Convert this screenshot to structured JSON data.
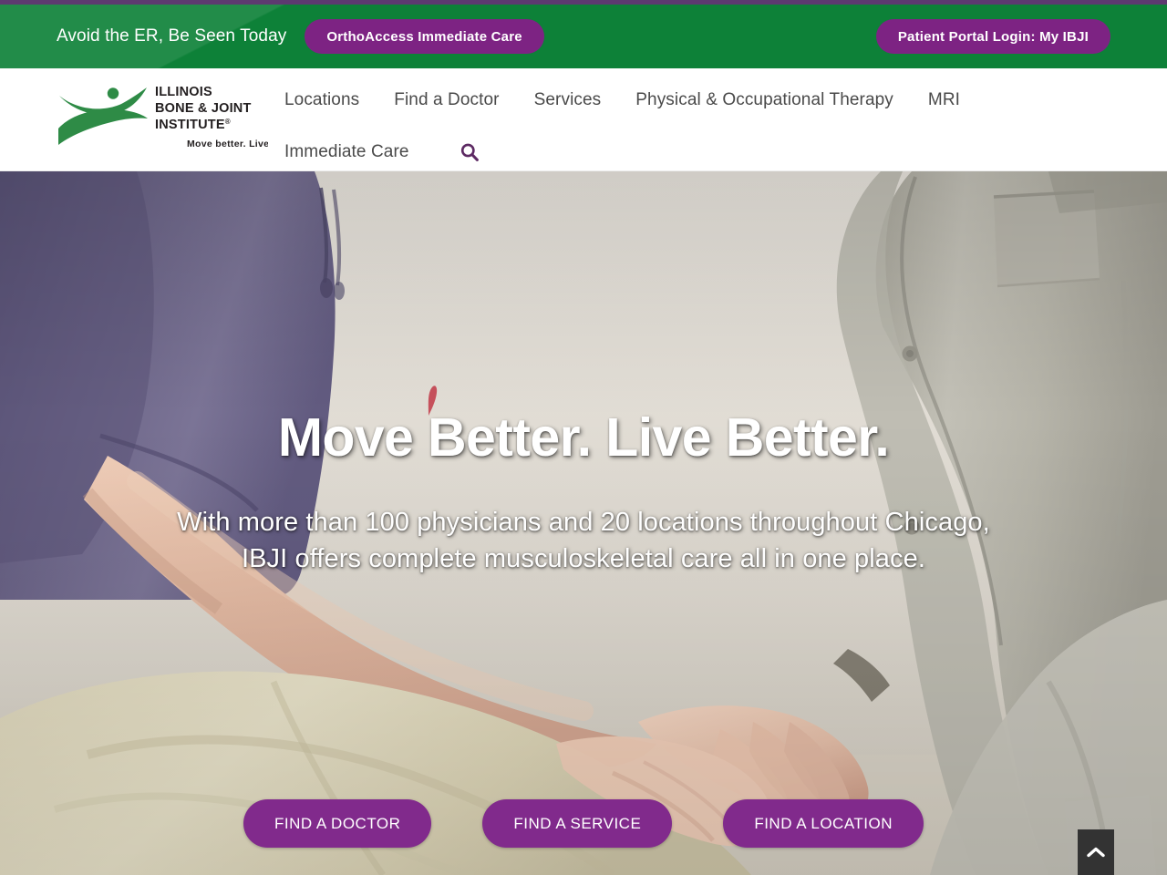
{
  "utility_bar": {
    "tagline": "Avoid the ER, Be Seen Today",
    "ortho_button": "OrthoAccess Immediate Care",
    "portal_button": "Patient Portal Login: My IBJI",
    "background_color": "#0d8138",
    "accent_color": "#7d2383",
    "strip_color": "#5d3a70"
  },
  "logo": {
    "line1": "ILLINOIS",
    "line2": "BONE & JOINT",
    "line3": "INSTITUTE",
    "registered_mark": "®",
    "tagline": "Move better. Live better.",
    "mark_color": "#2e8b46",
    "text_color": "#231f20"
  },
  "nav": {
    "row1": [
      {
        "label": "Locations",
        "name": "nav-item-locations"
      },
      {
        "label": "Find a Doctor",
        "name": "nav-item-find-a-doctor"
      },
      {
        "label": "Services",
        "name": "nav-item-services"
      },
      {
        "label": "Physical & Occupational Therapy",
        "name": "nav-item-physical-occupational-therapy"
      },
      {
        "label": "MRI",
        "name": "nav-item-mri"
      }
    ],
    "row2": [
      {
        "label": "Immediate Care",
        "name": "nav-item-immediate-care"
      }
    ],
    "search_icon": "search-icon",
    "search_icon_color": "#5d2a63"
  },
  "hero": {
    "title": "Move Better. Live Better.",
    "subtitle_line1": "With more than 100 physicians and 20 locations throughout Chicago,",
    "subtitle_line2": "IBJI offers complete musculoskeletal care all in one place.",
    "buttons": [
      {
        "label": "FIND A DOCTOR",
        "name": "find-a-doctor-button"
      },
      {
        "label": "FIND A SERVICE",
        "name": "find-a-service-button"
      },
      {
        "label": "FIND A LOCATION",
        "name": "find-a-location-button"
      }
    ],
    "button_color": "#812a8c",
    "image_description": "Doctor in gray lab coat examining a seated patient's hand; patient wears a purple polo shirt and khaki pants"
  },
  "scroll_top": {
    "icon": "chevron-up-icon",
    "background_color": "#333333"
  }
}
